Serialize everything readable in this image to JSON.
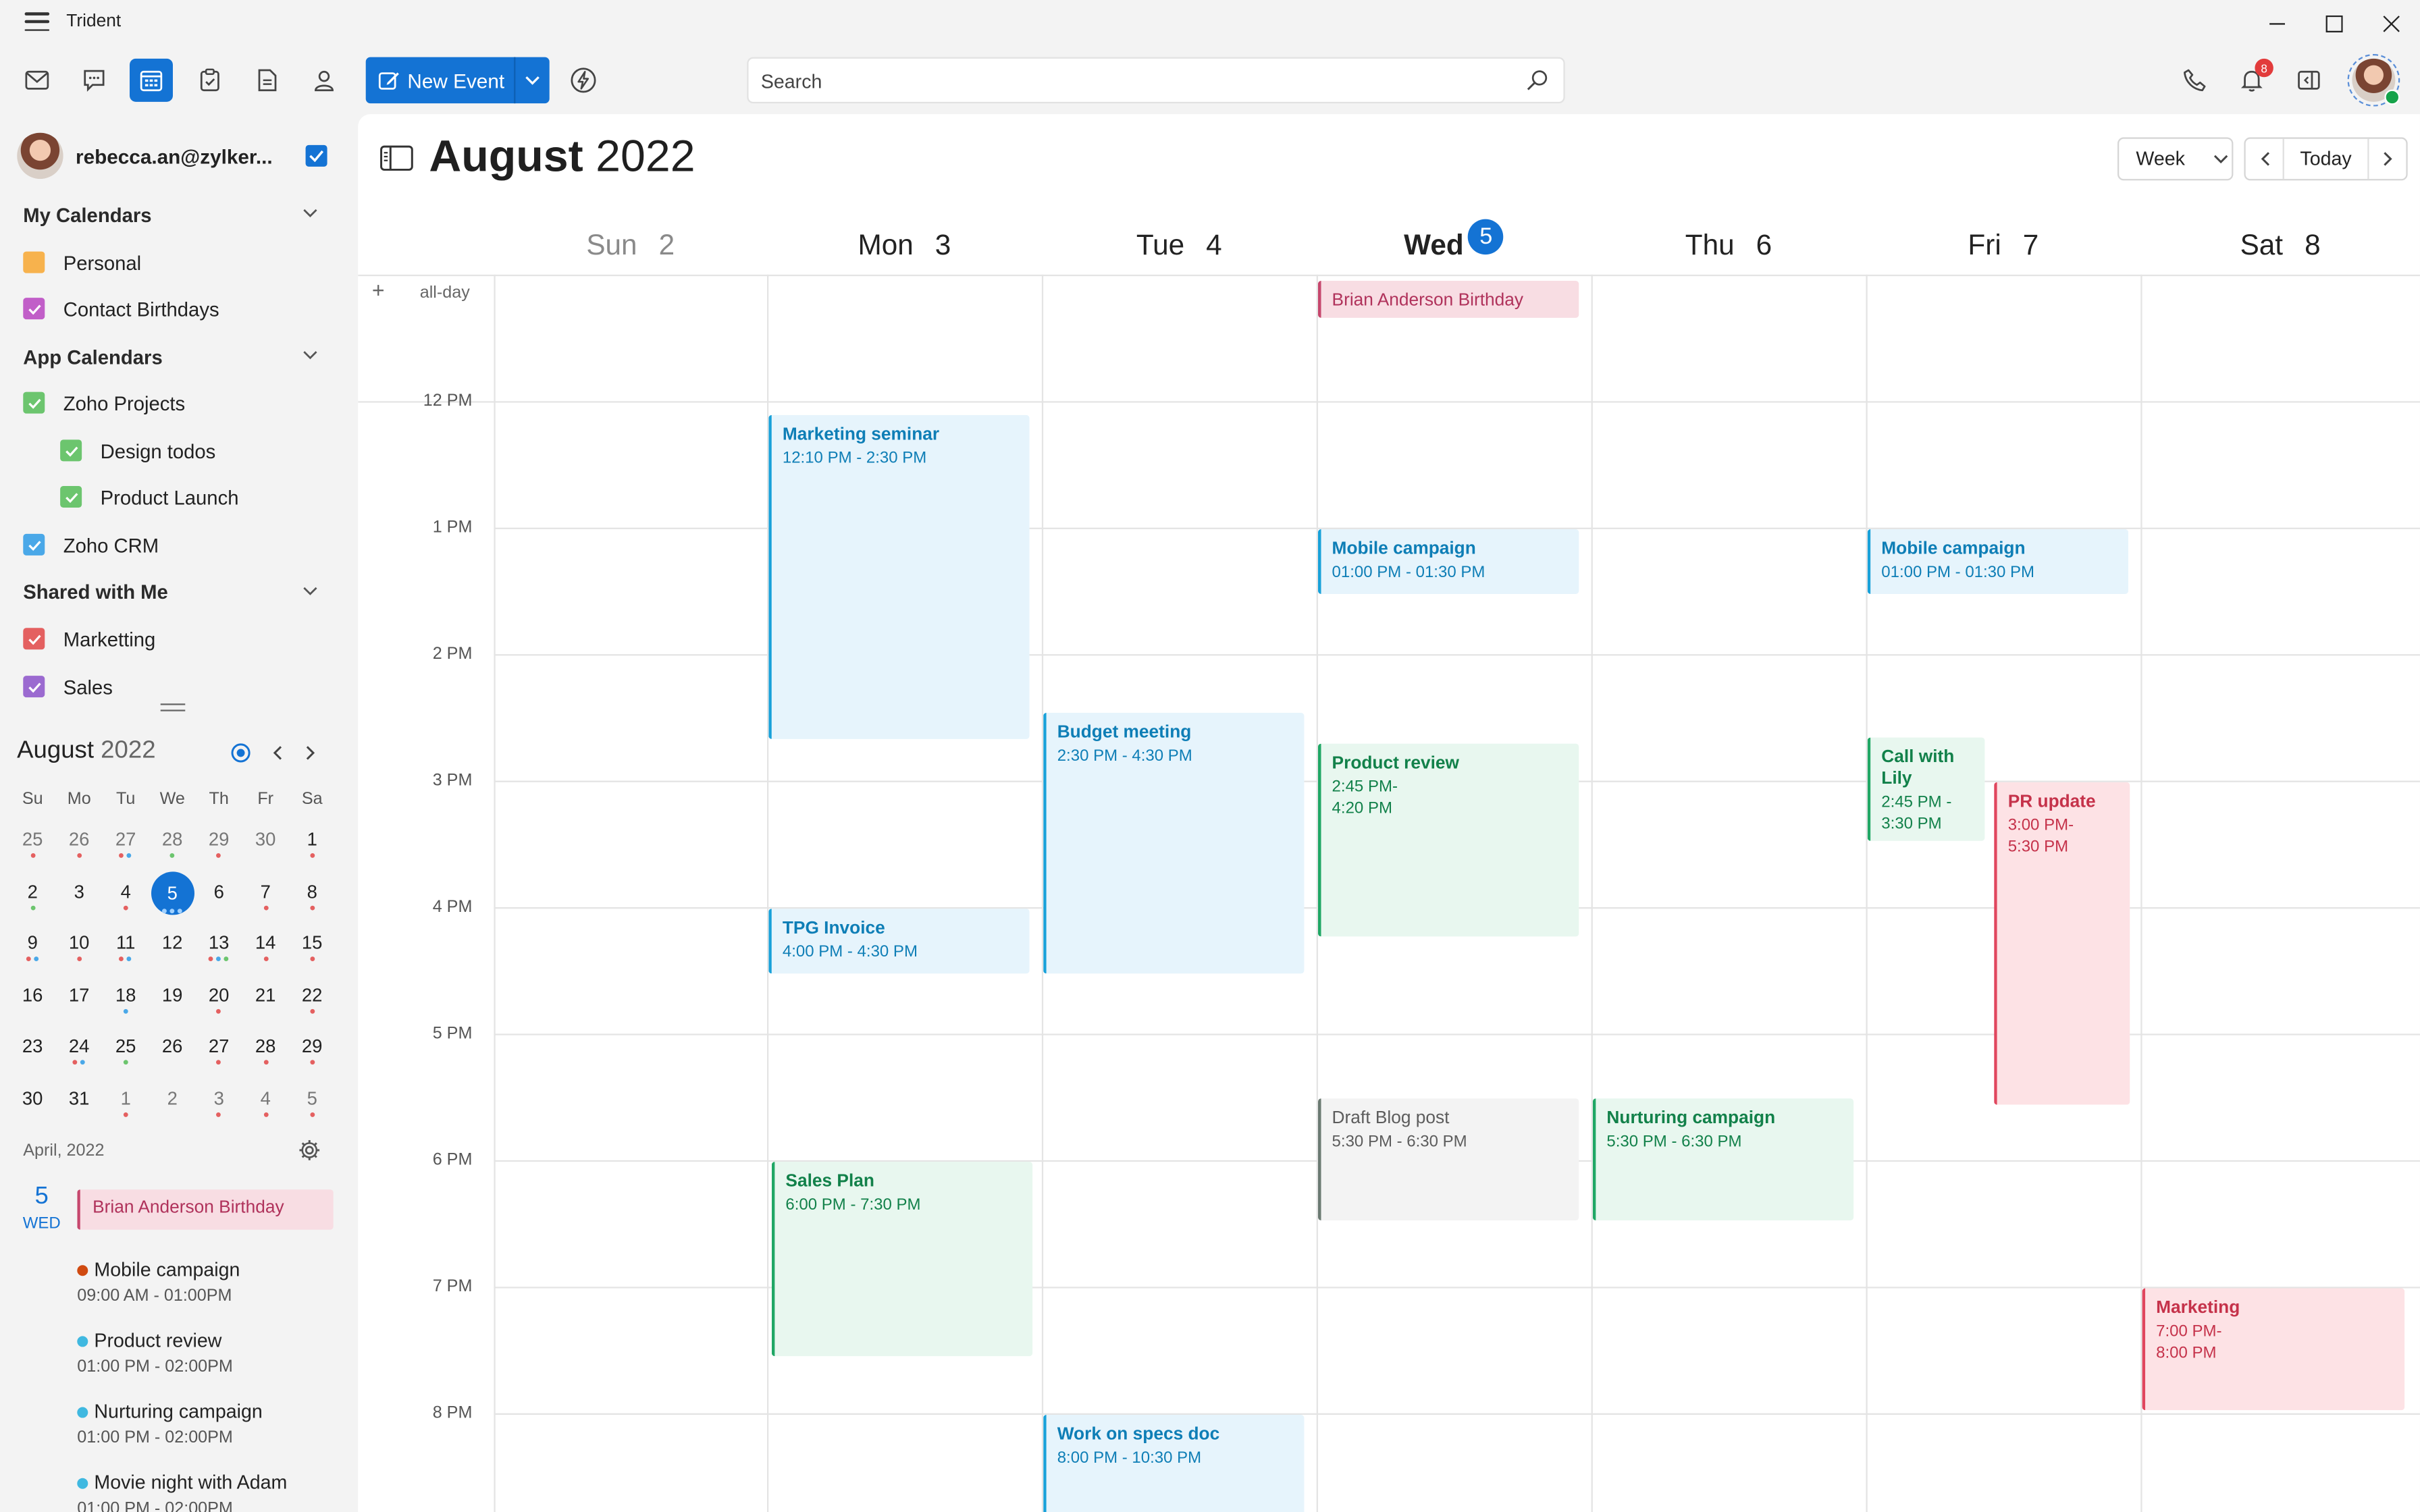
{
  "app": {
    "title": "Trident"
  },
  "toolbar": {
    "new_event": "New Event",
    "search_placeholder": "Search",
    "notification_count": "8"
  },
  "sidebar": {
    "account": "rebecca.an@zylker...",
    "groups": [
      {
        "title": "My Calendars",
        "items": [
          {
            "label": "Personal",
            "color": "#f7b24d"
          },
          {
            "label": "Contact Birthdays",
            "color": "#c15ec8"
          }
        ]
      },
      {
        "title": "App Calendars",
        "items": [
          {
            "label": "Zoho Projects",
            "color": "#6cc56e"
          },
          {
            "label": "Design todos",
            "color": "#6cc56e"
          },
          {
            "label": "Product Launch",
            "color": "#6cc56e"
          },
          {
            "label": "Zoho CRM",
            "color": "#4aa8e8"
          }
        ]
      },
      {
        "title": "Shared with Me",
        "items": [
          {
            "label": "Marketting",
            "color": "#e46060"
          },
          {
            "label": "Sales",
            "color": "#9b6ad0"
          }
        ]
      }
    ]
  },
  "mini_calendar": {
    "month": "August",
    "year": "2022",
    "weekdays": [
      "Su",
      "Mo",
      "Tu",
      "We",
      "Th",
      "Fr",
      "Sa"
    ],
    "weeks": [
      [
        "25",
        "26",
        "27",
        "28",
        "29",
        "30",
        "1"
      ],
      [
        "2",
        "3",
        "4",
        "5",
        "6",
        "7",
        "8"
      ],
      [
        "9",
        "10",
        "11",
        "12",
        "13",
        "14",
        "15"
      ],
      [
        "16",
        "17",
        "18",
        "19",
        "20",
        "21",
        "22"
      ],
      [
        "23",
        "24",
        "25",
        "26",
        "27",
        "28",
        "29"
      ],
      [
        "30",
        "31",
        "1",
        "2",
        "3",
        "4",
        "5"
      ]
    ]
  },
  "agenda": {
    "month_label": "April, 2022",
    "day_number": "5",
    "day_name": "WED",
    "birthday": "Brian Anderson Birthday",
    "events": [
      {
        "title": "Mobile campaign",
        "time": "09:00 AM - 01:00PM",
        "color": "#d04a10"
      },
      {
        "title": "Product review",
        "time": "01:00 PM - 02:00PM",
        "color": "#3fb8e0"
      },
      {
        "title": "Nurturing campaign",
        "time": "01:00 PM - 02:00PM",
        "color": "#3fb8e0"
      },
      {
        "title": "Movie night with Adam",
        "time": "01:00 PM - 02:00PM",
        "color": "#3fb8e0"
      }
    ]
  },
  "calendar": {
    "month": "August",
    "year": "2022",
    "view": "Week",
    "today_label": "Today",
    "allday_label": "all-day",
    "days": [
      {
        "name": "Sun",
        "num": "2"
      },
      {
        "name": "Mon",
        "num": "3"
      },
      {
        "name": "Tue",
        "num": "4"
      },
      {
        "name": "Wed",
        "num": "5"
      },
      {
        "name": "Thu",
        "num": "6"
      },
      {
        "name": "Fri",
        "num": "7"
      },
      {
        "name": "Sat",
        "num": "8"
      }
    ],
    "hours": [
      "12 PM",
      "1 PM",
      "2 PM",
      "3 PM",
      "4 PM",
      "5 PM",
      "6 PM",
      "7 PM",
      "8 PM"
    ],
    "allday_event": "Brian Anderson Birthday",
    "events": [
      {
        "title": "Marketing seminar",
        "time": "12:10 PM - 2:30 PM"
      },
      {
        "title": "TPG Invoice",
        "time": "4:00 PM - 4:30 PM"
      },
      {
        "title": "Sales Plan",
        "time": "6:00 PM - 7:30 PM"
      },
      {
        "title": "Budget meeting",
        "time": "2:30 PM - 4:30 PM"
      },
      {
        "title": "Work on specs doc",
        "time": "8:00 PM - 10:30 PM"
      },
      {
        "title": "Mobile campaign",
        "time": "01:00 PM - 01:30 PM"
      },
      {
        "title": "Product review",
        "time": "2:45 PM-\n4:20 PM"
      },
      {
        "title": "Draft Blog post",
        "time": "5:30 PM - 6:30 PM"
      },
      {
        "title": "Nurturing campaign",
        "time": "5:30 PM - 6:30 PM"
      },
      {
        "title": "Mobile campaign",
        "time": "01:00 PM - 01:30 PM"
      },
      {
        "title": "Call with Lily",
        "time": "2:45 PM - 3:30 PM"
      },
      {
        "title": "PR update",
        "time": "3:00 PM-\n5:30 PM"
      },
      {
        "title": "Marketing",
        "time": "7:00 PM-\n8:00 PM"
      }
    ]
  }
}
